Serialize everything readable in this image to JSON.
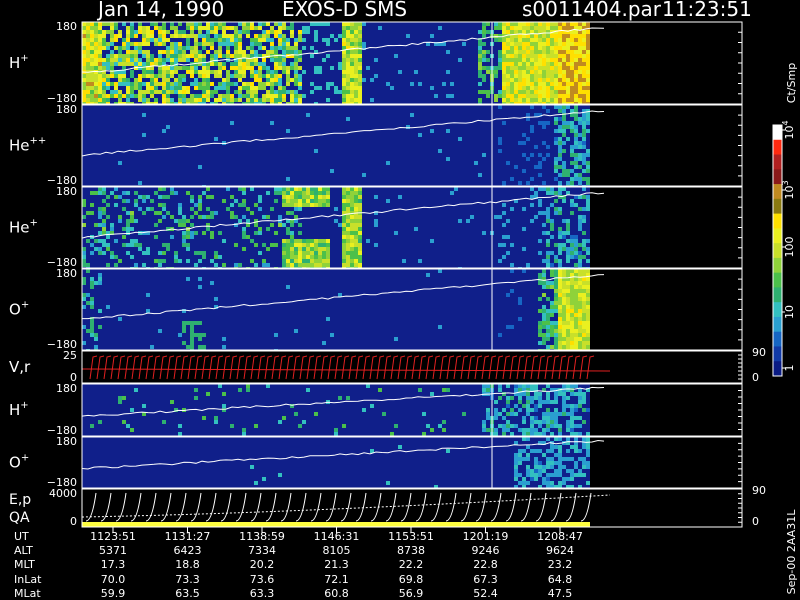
{
  "header": {
    "date": "Jan 14, 1990",
    "instrument": "EXOS-D SMS",
    "file": "s0011404.par",
    "time": "11:23:51"
  },
  "colorbar": {
    "unit_label": "Ct/Smp",
    "tick_labels": [
      "1",
      "10",
      "100",
      "10",
      "10"
    ],
    "tick_exponents": [
      "",
      "",
      "",
      "3",
      "4"
    ]
  },
  "footer_code": "Sep-00 2AA31L",
  "panels": [
    {
      "label": "H",
      "superscript": "+",
      "top_tick": "180",
      "bottom_tick": "−180"
    },
    {
      "label": "He",
      "superscript": "++",
      "top_tick": "180",
      "bottom_tick": "−180"
    },
    {
      "label": "He",
      "superscript": "+",
      "top_tick": "180",
      "bottom_tick": "−180"
    },
    {
      "label": "O",
      "superscript": "+",
      "top_tick": "180",
      "bottom_tick": "−180"
    },
    {
      "label": "V,r",
      "superscript": "",
      "top_tick": "25",
      "bottom_tick": "0",
      "right_top": "90",
      "right_bottom": "0"
    },
    {
      "label": "H",
      "superscript": "+",
      "top_tick": "180",
      "bottom_tick": "−180"
    },
    {
      "label": "O",
      "superscript": "+",
      "top_tick": "180",
      "bottom_tick": "−180"
    },
    {
      "label": "E,p",
      "label2": "QA",
      "superscript": "",
      "top_tick": "4000",
      "bottom_tick": "0",
      "right_top": "90",
      "right_bottom": "0"
    }
  ],
  "chart_data": {
    "type": "heatmap",
    "title": "Jan 14, 1990   EXOS-D SMS",
    "x_axis": "UT",
    "time_ticks": [
      "1123:51",
      "1131:27",
      "1138:59",
      "1146:31",
      "1153:51",
      "1201:19",
      "1208:47"
    ],
    "pitch_angle_range": [
      -180,
      180
    ],
    "color_scale": "log",
    "color_range": [
      1,
      10000
    ],
    "orbit_table": {
      "rows": [
        {
          "name": "UT",
          "values": [
            "1123:51",
            "1131:27",
            "1138:59",
            "1146:31",
            "1153:51",
            "1201:19",
            "1208:47"
          ]
        },
        {
          "name": "ALT",
          "values": [
            "5371",
            "6423",
            "7334",
            "8105",
            "8738",
            "9246",
            "9624"
          ]
        },
        {
          "name": "MLT",
          "values": [
            "17.3",
            "18.8",
            "20.2",
            "21.3",
            "22.2",
            "22.8",
            "23.2"
          ]
        },
        {
          "name": "InLat",
          "values": [
            "70.0",
            "73.3",
            "73.6",
            "72.1",
            "69.8",
            "67.3",
            "64.8"
          ]
        },
        {
          "name": "MLat",
          "values": [
            "59.9",
            "63.5",
            "63.3",
            "60.8",
            "56.9",
            "52.4",
            "47.5"
          ]
        }
      ]
    }
  }
}
